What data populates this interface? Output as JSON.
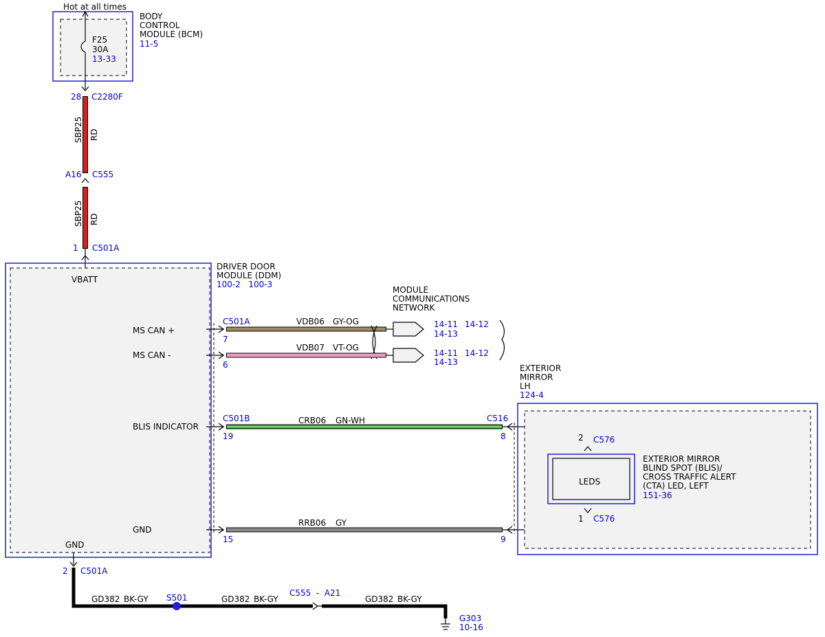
{
  "colors": {
    "red": "#d81e1e",
    "gy_og": "#a08a62",
    "vt_og": "#ef9bc6",
    "gn_wh": "#22a822",
    "gy": "#8a8a8a",
    "bk_gy": "#000000",
    "ref_blue": "#0000cc"
  },
  "bcm": {
    "hot_label": "Hot at all times",
    "name_lines": [
      "BODY",
      "CONTROL",
      "MODULE (BCM)"
    ],
    "ref": "11-5",
    "fuse_name": "F25",
    "fuse_rating": "30A",
    "fuse_ref": "13-33"
  },
  "power_wire": {
    "pin_top": "28",
    "connector_top": "C2280F",
    "circuit": "SBP25",
    "color": "RD",
    "pin_mid": "A16",
    "connector_mid": "C555",
    "pin_bottom": "1",
    "connector_bottom": "C501A"
  },
  "ddm": {
    "name_lines": [
      "DRIVER DOOR",
      "MODULE (DDM)"
    ],
    "refs": "100-2   100-3",
    "vbatt": "VBATT",
    "ms_can_plus": "MS CAN +",
    "ms_can_minus": "MS CAN -",
    "blis": "BLIS INDICATOR",
    "gnd_label": "GND",
    "gnd_bottom": "GND",
    "gnd_pin": "2",
    "gnd_connector": "C501A"
  },
  "network": {
    "name_lines": [
      "MODULE",
      "COMMUNICATIONS",
      "NETWORK"
    ],
    "connector": "C501A",
    "plus_pin": "7",
    "plus_circuit": "VDB06",
    "plus_color": "GY-OG",
    "plus_ref_a": "14-11",
    "plus_ref_b": "14-12",
    "plus_ref_c": "14-13",
    "minus_pin": "6",
    "minus_circuit": "VDB07",
    "minus_color": "VT-OG",
    "minus_ref_a": "14-11",
    "minus_ref_b": "14-12",
    "minus_ref_c": "14-13"
  },
  "blis_wire": {
    "connector_left": "C501B",
    "pin_left": "19",
    "circuit": "CRB06",
    "color": "GN-WH",
    "connector_right": "C516",
    "pin_right": "8"
  },
  "gnd_wire": {
    "pin_left": "15",
    "circuit": "RRB06",
    "color": "GY",
    "pin_right": "9"
  },
  "mirror": {
    "name_lines": [
      "EXTERIOR",
      "MIRROR",
      "LH"
    ],
    "ref": "124-4",
    "pin_top": "2",
    "conn_top": "C576",
    "pin_bottom": "1",
    "conn_bottom": "C576",
    "leds": "LEDS",
    "led_name_lines": [
      "EXTERIOR MIRROR",
      "BLIND SPOT (BLIS)/",
      "CROSS TRAFFIC ALERT",
      "(CTA) LED, LEFT"
    ],
    "led_ref": "151-36"
  },
  "ground": {
    "seg1_circuit": "GD382",
    "seg1_color": "BK-GY",
    "splice": "S501",
    "seg2_circuit": "GD382",
    "seg2_color": "BK-GY",
    "inline_connector": "C555  -  A21",
    "seg3_circuit": "GD382",
    "seg3_color": "BK-GY",
    "ground_point": "G303",
    "ground_ref": "10-16"
  }
}
